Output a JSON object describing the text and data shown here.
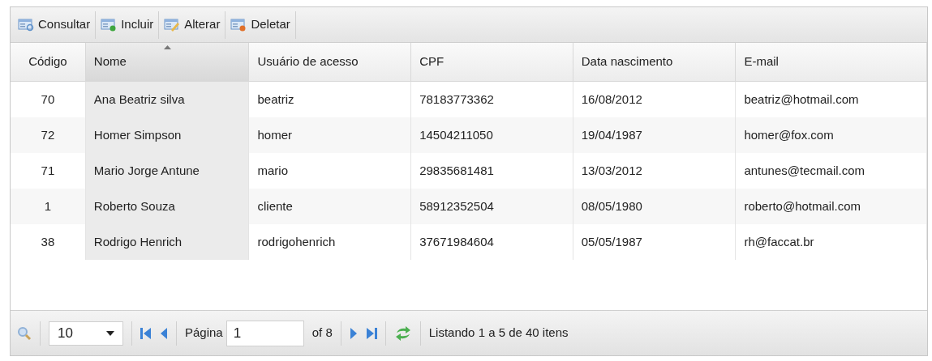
{
  "toolbar": [
    {
      "label": "Consultar",
      "kind": "view"
    },
    {
      "label": "Incluir",
      "kind": "add"
    },
    {
      "label": "Alterar",
      "kind": "edit"
    },
    {
      "label": "Deletar",
      "kind": "delete"
    }
  ],
  "table": {
    "columns": [
      {
        "label": "Código",
        "sorted": false
      },
      {
        "label": "Nome",
        "sorted": true
      },
      {
        "label": "Usuário de acesso",
        "sorted": false
      },
      {
        "label": "CPF",
        "sorted": false
      },
      {
        "label": "Data nascimento",
        "sorted": false
      },
      {
        "label": "E-mail",
        "sorted": false
      }
    ],
    "rows": [
      [
        "70",
        "Ana Beatriz silva",
        "beatriz",
        "78183773362",
        "16/08/2012",
        "beatriz@hotmail.com"
      ],
      [
        "72",
        "Homer Simpson",
        "homer",
        "14504211050",
        "19/04/1987",
        "homer@fox.com"
      ],
      [
        "71",
        "Mario Jorge Antune",
        "mario",
        "29835681481",
        "13/03/2012",
        "antunes@tecmail.com"
      ],
      [
        "1",
        "Roberto Souza",
        "cliente",
        "58912352504",
        "08/05/1980",
        "roberto@hotmail.com"
      ],
      [
        "38",
        "Rodrigo Henrich",
        "rodrigohenrich",
        "37671984604",
        "05/05/1987",
        "rh@faccat.br"
      ]
    ]
  },
  "pager": {
    "page_size": "10",
    "page_label": "Página",
    "page": "1",
    "of": "of 8",
    "status": "Listando 1 a 5 de 40 itens"
  }
}
